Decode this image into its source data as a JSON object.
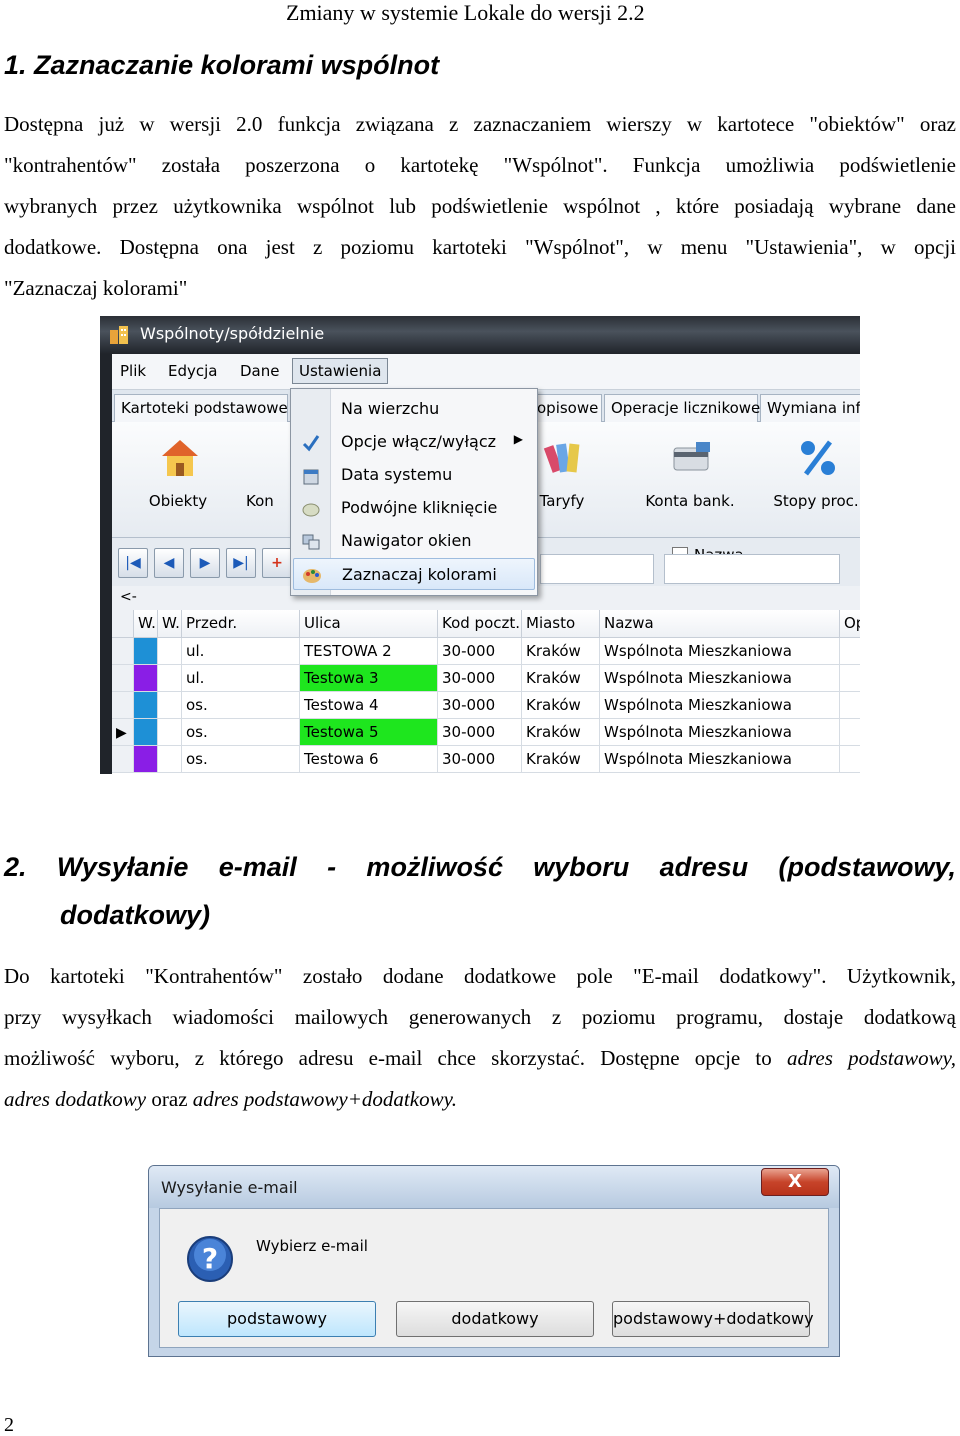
{
  "header": "Zmiany w systemie Lokale do wersji 2.2",
  "section1": {
    "heading": "1.   Zaznaczanie kolorami wspólnot",
    "lines": [
      "Dostępna już w wersji 2.0 funkcja związana z zaznaczaniem wierszy w kartotece \"obiektów\" oraz",
      "\"kontrahentów\" została poszerzona o kartotekę \"Wspólnot\". Funkcja umożliwia podświetlenie",
      "wybranych przez użytkownika wspólnot lub podświetlenie wspólnot , które posiadają wybrane dane",
      "dodatkowe. Dostępna ona jest z poziomu kartoteki \"Wspólnot\", w menu \"Ustawienia\", w opcji",
      "\"Zaznaczaj kolorami\""
    ]
  },
  "screenshot1": {
    "window_title": "Wspólnoty/spółdzielnie",
    "menu": [
      "Plik",
      "Edycja",
      "Dane",
      "Ustawienia"
    ],
    "tabs": [
      "Kartoteki podstawowe",
      "opisowe",
      "Operacje licznikowe",
      "Wymiana info"
    ],
    "ribbon": [
      "Obiekty",
      "Kon",
      "Taryfy",
      "Konta bank.",
      "Stopy proc."
    ],
    "dropdown": [
      {
        "label": "Na wierzchu",
        "icon": "none"
      },
      {
        "label": "Opcje włącz/wyłącz",
        "icon": "checkmark-icon",
        "submenu": true
      },
      {
        "label": "Data systemu",
        "icon": "calendar-icon"
      },
      {
        "label": "Podwójne kliknięcie",
        "icon": "mouse-icon"
      },
      {
        "label": "Nawigator okien",
        "icon": "windows-icon"
      },
      {
        "label": "Zaznaczaj kolorami",
        "icon": "palette-icon",
        "highlighted": true
      }
    ],
    "checkbox_label": "Nazwa",
    "scroll_marker": "<-",
    "columns": [
      "W.",
      "W.",
      "Przedr.",
      "Ulica",
      "Kod poczt.",
      "Miasto",
      "Nazwa",
      "Op"
    ],
    "rows": [
      {
        "c1": "#1e90d6",
        "przedr": "ul.",
        "ulica": "TESTOWA 2",
        "ulica_bg": "",
        "kod": "30-000",
        "miasto": "Kraków",
        "nazwa": "Wspólnota Mieszkaniowa",
        "current": false
      },
      {
        "c1": "#8a1ee6",
        "przedr": "ul.",
        "ulica": "Testowa 3",
        "ulica_bg": "#1ee61e",
        "kod": "30-000",
        "miasto": "Kraków",
        "nazwa": "Wspólnota Mieszkaniowa",
        "current": false
      },
      {
        "c1": "#1e90d6",
        "przedr": "os.",
        "ulica": "Testowa 4",
        "ulica_bg": "",
        "kod": "30-000",
        "miasto": "Kraków",
        "nazwa": "Wspólnota Mieszkaniowa",
        "current": false
      },
      {
        "c1": "#1e90d6",
        "przedr": "os.",
        "ulica": "Testowa 5",
        "ulica_bg": "#1ee61e",
        "kod": "30-000",
        "miasto": "Kraków",
        "nazwa": "Wspólnota Mieszkaniowa",
        "current": true
      },
      {
        "c1": "#8a1ee6",
        "przedr": "os.",
        "ulica": "Testowa 6",
        "ulica_bg": "",
        "kod": "30-000",
        "miasto": "Kraków",
        "nazwa": "Wspólnota Mieszkaniowa",
        "current": false
      }
    ]
  },
  "section2": {
    "heading_line1": "2.   Wysyłanie   e-mail   -   możliwość   wyboru   adresu   (podstawowy,",
    "heading_line2": "dodatkowy)",
    "line1": "Do kartoteki  \"Kontrahentów\" zostało dodane dodatkowe pole \"E-mail dodatkowy\". Użytkownik,",
    "line2": "przy  wysyłkach wiadomości mailowych generowanych z poziomu programu, dostaje dodatkową",
    "line3_a": "możliwość wyboru, z którego adresu e-mail chce skorzystać. Dostępne opcje to ",
    "line3_b": "adres podstawowy,",
    "line4_a": "adres dodatkowy",
    "line4_b": " oraz ",
    "line4_c": "adres podstawowy+dodatkowy",
    "line4_d": "."
  },
  "screenshot2": {
    "window_title": "Wysyłanie e-mail",
    "close": "X",
    "message": "Wybierz e-mail",
    "buttons": [
      "podstawowy",
      "dodatkowy",
      "podstawowy+dodatkowy"
    ]
  },
  "page_number": "2"
}
